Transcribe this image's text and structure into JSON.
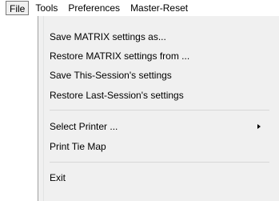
{
  "menubar": {
    "items": [
      {
        "label": "File"
      },
      {
        "label": "Tools"
      },
      {
        "label": "Preferences"
      },
      {
        "label": "Master-Reset"
      }
    ]
  },
  "file_menu": {
    "items": [
      {
        "label": "Save MATRIX settings as..."
      },
      {
        "label": "Restore MATRIX settings from ..."
      },
      {
        "label": "Save This-Session's settings"
      },
      {
        "label": "Restore Last-Session's settings"
      },
      {
        "label": "Select Printer ...",
        "submenu_icon": "triangle-right-icon"
      },
      {
        "label": "Print Tie Map"
      },
      {
        "label": "Exit"
      }
    ]
  }
}
